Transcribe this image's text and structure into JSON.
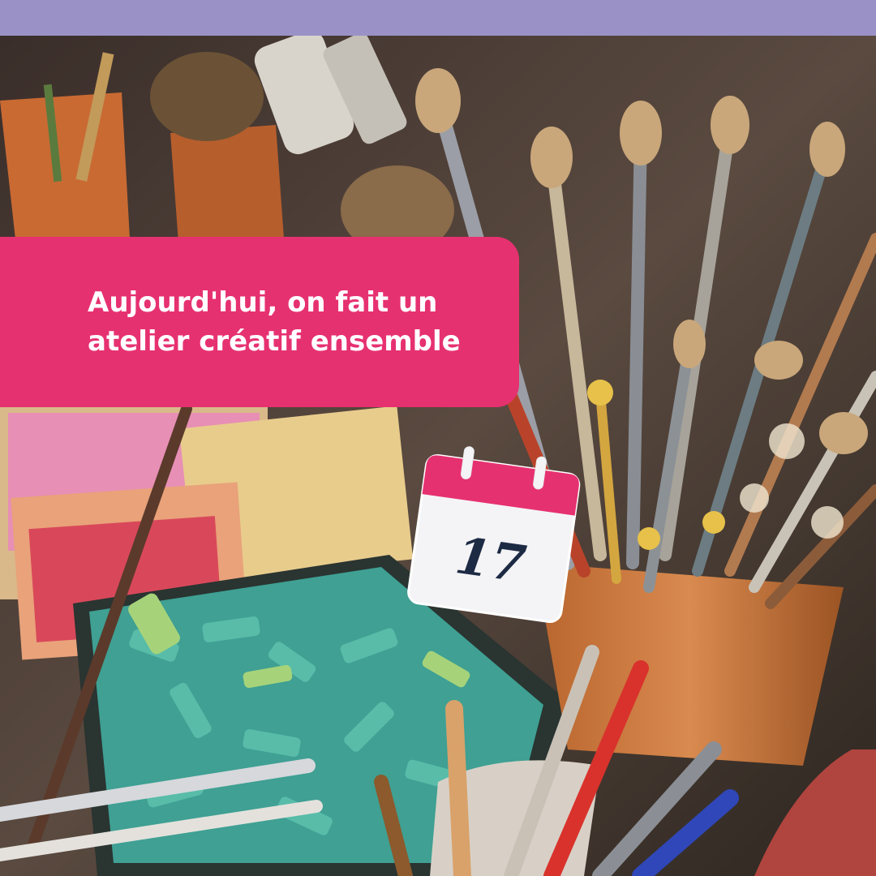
{
  "colors": {
    "top_band": "#9a92c6",
    "caption_background": "#e63170",
    "caption_text": "#ffffff",
    "calendar_header": "#e63170",
    "calendar_body": "#f4f4f6",
    "calendar_number": "#1d2a44"
  },
  "caption": {
    "text": "Aujourd'hui, on fait un atelier créatif ensemble"
  },
  "calendar": {
    "icon": "calendar-icon",
    "day": "17"
  },
  "photo": {
    "icon": "art-supplies-photo"
  }
}
